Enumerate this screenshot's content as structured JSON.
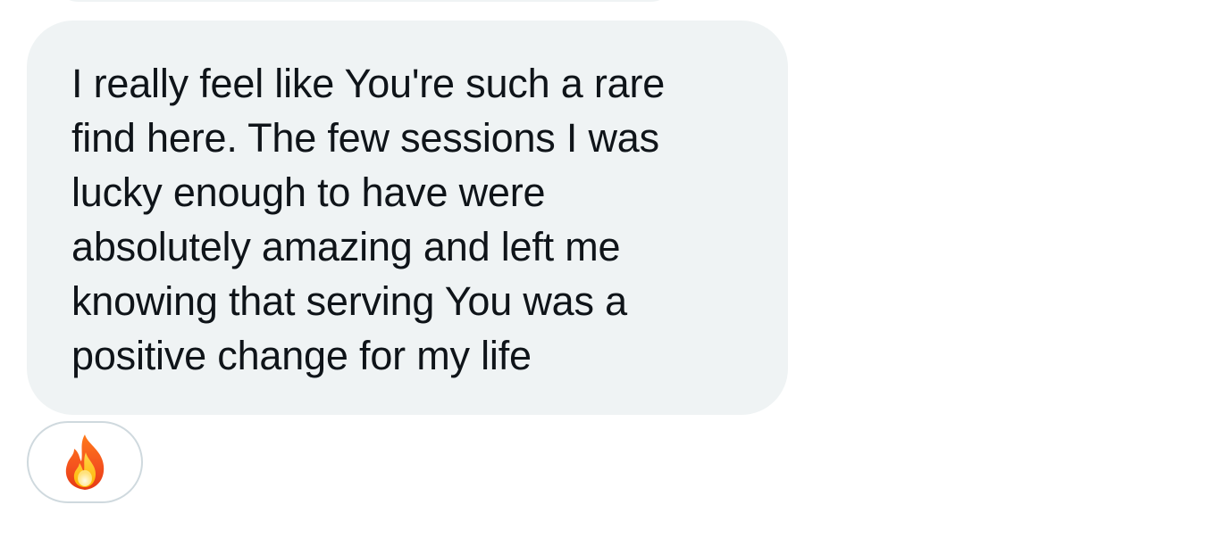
{
  "conversation": {
    "message": {
      "text": "I really feel like You're such a rare\nfind here. The few sessions I was\nlucky enough to have were\nabsolutely amazing and left me\nknowing that serving You was a\npositive change for my life"
    },
    "reaction": {
      "emoji_icon": "fire-icon"
    }
  },
  "colors": {
    "bubble_background": "#eff3f4",
    "message_text": "#0f1419",
    "reaction_border": "#cfd9de",
    "page_background": "#ffffff"
  }
}
